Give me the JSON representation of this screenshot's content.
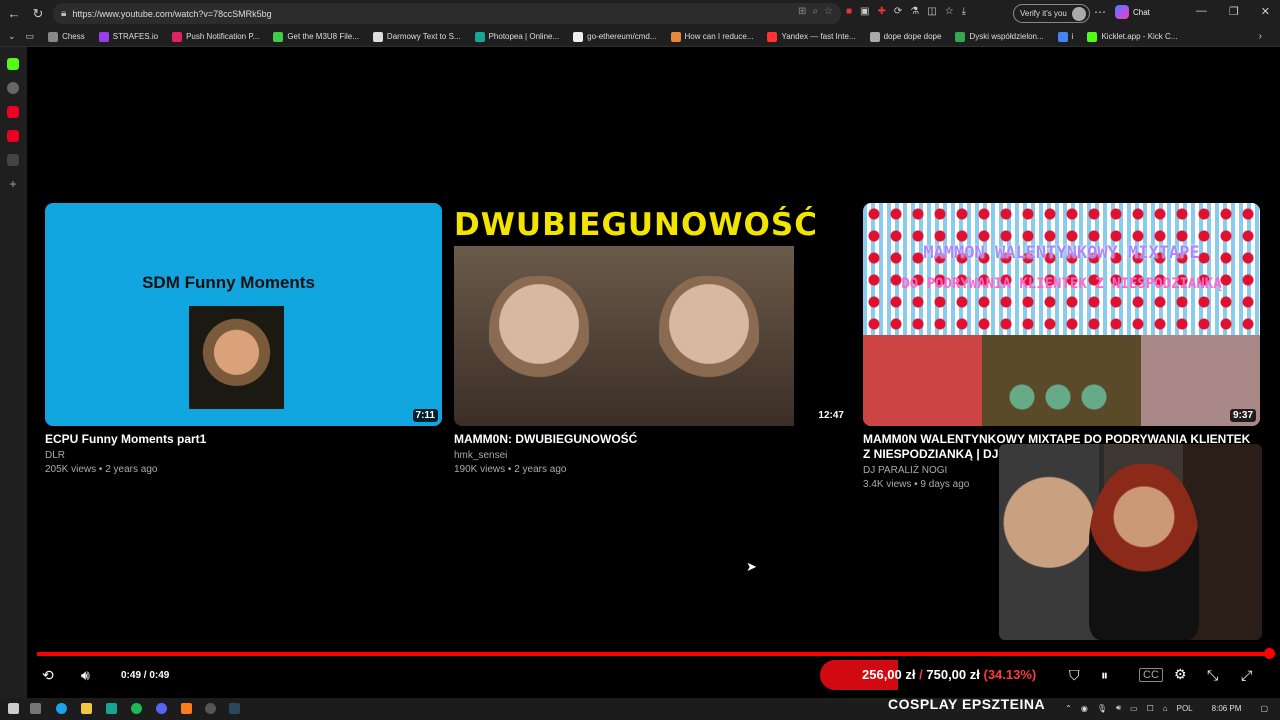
{
  "browser": {
    "url": "https://www.youtube.com/watch?v=78ccSMRk5bg",
    "verify_label": "Verify it's you",
    "chat_label": "Chat"
  },
  "bookmarks": [
    {
      "label": "Chess",
      "color": "#888888"
    },
    {
      "label": "STRAFES.io",
      "color": "#9b3cf0"
    },
    {
      "label": "Push Notification P...",
      "color": "#e0245e"
    },
    {
      "label": "Get the M3U8 File...",
      "color": "#3ecf4a"
    },
    {
      "label": "Darmowy Text to S...",
      "color": "#dddddd"
    },
    {
      "label": "Photopea | Online...",
      "color": "#18a497"
    },
    {
      "label": "go-ethereum/cmd...",
      "color": "#eeeeee"
    },
    {
      "label": "How can I reduce...",
      "color": "#e8893a"
    },
    {
      "label": "Yandex — fast Inte...",
      "color": "#ff3333"
    },
    {
      "label": "dope dope dope",
      "color": "#aaaaaa"
    },
    {
      "label": "Dyski współdzielon...",
      "color": "#34a853"
    },
    {
      "label": "i",
      "color": "#4285f4"
    },
    {
      "label": "Kicklet.app - Kick C...",
      "color": "#53fc18"
    }
  ],
  "videos": [
    {
      "thumb_title": "SDM Funny Moments",
      "duration": "7:11",
      "title": "ECPU Funny Moments part1",
      "channel": "DLR",
      "meta": "205K views • 2 years ago"
    },
    {
      "thumb_title": "DWUBIEGUNOWOŚĆ",
      "duration": "12:47",
      "title": "MAMM0N: DWUBIEGUNOWOŚĆ",
      "channel": "hmk_sensei",
      "meta": "190K views • 2 years ago"
    },
    {
      "thumb_title_1": "MAMMON WALENTYNKOWY MIXTAPE",
      "thumb_title_2": "DO PODRYWANIA KLIENTEK Z NIESPODZIANKĄ",
      "duration": "9:37",
      "title": "MAMM0N WALENTYNKOWY MIXTAPE DO PODRYWANIA KLIENTEK Z NIESPODZIANKĄ | DJ PA",
      "channel": "DJ PARALIŻ NOGI",
      "meta": "3.4K views • 9 days ago"
    }
  ],
  "player": {
    "time": "0:49 / 0:49",
    "progress": 1.0
  },
  "donation": {
    "current": "256,00 zł",
    "separator": "/",
    "goal": "750,00 zł",
    "percent_text": "(34.13%)",
    "fill_fraction": 0.3413
  },
  "overlay_caption": "COSPLAY EPSZTEINA",
  "taskbar": {
    "lang": "POL",
    "clock": "8:06 PM"
  },
  "colors": {
    "accent_red": "#ff0000",
    "donation_red": "#d10a12"
  }
}
